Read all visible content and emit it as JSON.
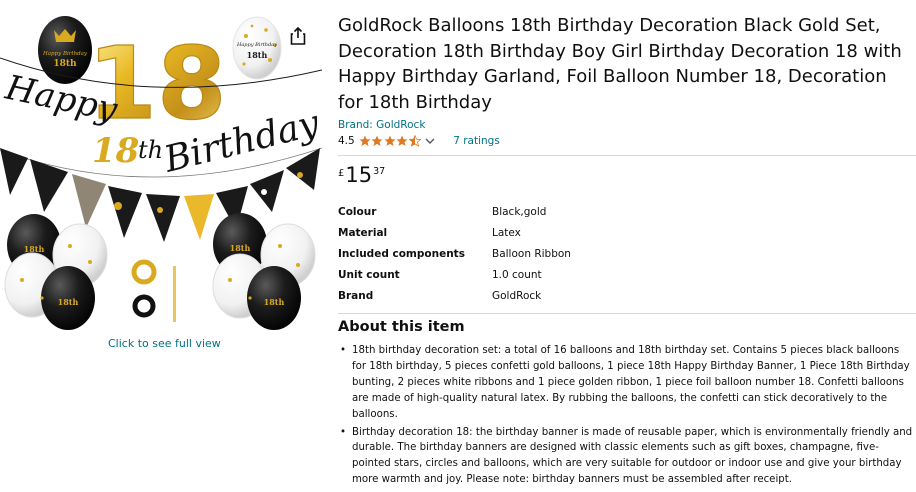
{
  "product": {
    "title": "GoldRock Balloons 18th Birthday Decoration Black Gold Set, Decoration 18th Birthday Boy Girl Birthday Decoration 18 with Happy Birthday Garland, Foil Balloon Number 18, Decoration for 18th Birthday",
    "brand_link": "Brand: GoldRock",
    "rating_value": "4.5",
    "rating_stars": 4.5,
    "ratings_count_link": "7 ratings"
  },
  "price": {
    "symbol": "£",
    "whole": "15",
    "fraction": "37"
  },
  "specs": [
    {
      "label": "Colour",
      "value": "Black,gold"
    },
    {
      "label": "Material",
      "value": "Latex"
    },
    {
      "label": "Included components",
      "value": "Balloon Ribbon"
    },
    {
      "label": "Unit count",
      "value": "1.0 count"
    },
    {
      "label": "Brand",
      "value": "GoldRock"
    }
  ],
  "about": {
    "title": "About this item",
    "bullets": [
      "18th birthday decoration set: a total of 16 balloons and 18th birthday set. Contains 5 pieces black balloons for 18th birthday, 5 pieces confetti gold balloons, 1 piece 18th Happy Birthday Banner, 1 Piece 18th Birthday bunting, 2 pieces white ribbons and 1 piece golden ribbon, 1 piece foil balloon number 18. Confetti balloons are made of high-quality natural latex. By rubbing the balloons, the confetti can stick decoratively to the balloons.",
      "Birthday decoration 18: the birthday banner is made of reusable paper, which is environmentally friendly and durable. The birthday banners are designed with classic elements such as gift boxes, champagne, five-pointed stars, circles and balloons, which are very suitable for outdoor or indoor use and give your birthday more warmth and joy. Please note: birthday banners must be assembled after receipt."
    ]
  },
  "image": {
    "full_view_link": "Click to see full view",
    "banner_script_top": "Happy",
    "banner_script_number": "18",
    "banner_script_th": "th",
    "banner_script_bottom": "Birthday",
    "foil_number": "18",
    "balloon_text_1": "Happy Birthday",
    "balloon_text_2": "18th"
  },
  "icons": {
    "share": "share-icon",
    "star": "star-icon",
    "chevron": "chevron-down-icon"
  },
  "colors": {
    "link": "#007185",
    "star": "#de7921",
    "text": "#0f1111",
    "gold": "#d9a920",
    "black": "#1a1a1a"
  }
}
